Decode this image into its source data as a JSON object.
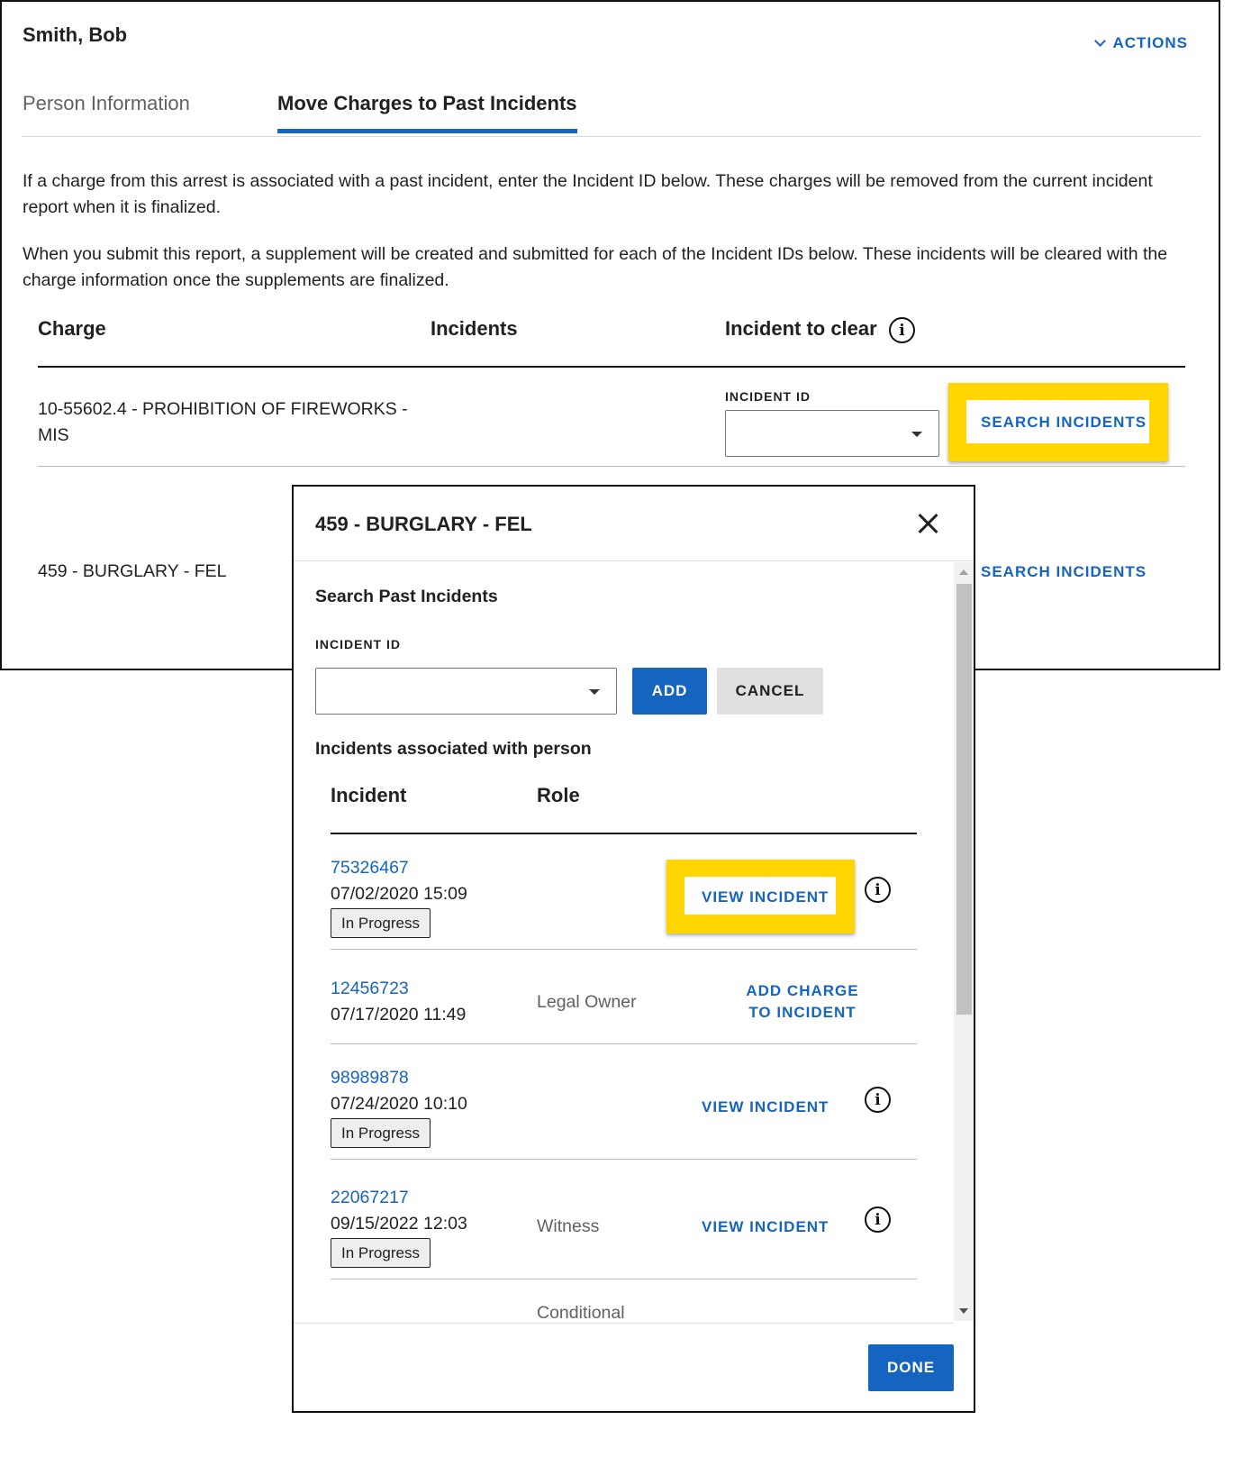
{
  "header": {
    "person_name": "Smith, Bob",
    "actions_label": "ACTIONS"
  },
  "tabs": [
    {
      "label": "Person Information",
      "active": false
    },
    {
      "label": "Move Charges to Past Incidents",
      "active": true
    }
  ],
  "instructions": {
    "p1": "If a charge from this arrest is associated with a past incident, enter the Incident ID below. These charges will be removed from the current incident report when it is finalized.",
    "p2": "When you submit this report, a supplement will be created and submitted for each of the Incident IDs below. These incidents will be cleared with the charge information once the supplements are finalized."
  },
  "charges_table": {
    "headers": {
      "charge": "Charge",
      "incidents": "Incidents",
      "incident_to_clear": "Incident to clear"
    },
    "rows": [
      {
        "charge": "10-55602.4 - PROHIBITION OF FIREWORKS - MIS",
        "field_label": "INCIDENT ID",
        "incident_id_value": "",
        "button": "SEARCH INCIDENTS"
      },
      {
        "charge": "459 - BURGLARY - FEL",
        "button": "SEARCH INCIDENTS"
      }
    ]
  },
  "modal": {
    "title": "459 - BURGLARY - FEL",
    "search_section_title": "Search Past Incidents",
    "field_label": "INCIDENT ID",
    "incident_id_value": "",
    "add_label": "ADD",
    "cancel_label": "CANCEL",
    "associated_title": "Incidents associated with person",
    "table_headers": {
      "incident": "Incident",
      "role": "Role"
    },
    "incidents": [
      {
        "id": "75326467",
        "datetime": "07/02/2020 15:09",
        "status": "In Progress",
        "role": "",
        "action": "VIEW INCIDENT"
      },
      {
        "id": "12456723",
        "datetime": "07/17/2020 11:49",
        "status": "",
        "role": "Legal Owner",
        "action": "ADD CHARGE TO INCIDENT"
      },
      {
        "id": "98989878",
        "datetime": "07/24/2020 10:10",
        "status": "In Progress",
        "role": "",
        "action": "VIEW INCIDENT"
      },
      {
        "id": "22067217",
        "datetime": "09/15/2022 12:03",
        "status": "In Progress",
        "role": "Witness",
        "action": "VIEW INCIDENT"
      },
      {
        "id": "",
        "datetime": "",
        "status": "",
        "role": "Conditional",
        "action": ""
      }
    ],
    "done_label": "DONE"
  },
  "colors": {
    "accent": "#1565c0",
    "highlight": "#ffd600",
    "text": "#212121",
    "muted": "#616161"
  },
  "icons": [
    "chevron-down-icon",
    "info-icon",
    "dropdown-caret-icon",
    "close-icon"
  ]
}
